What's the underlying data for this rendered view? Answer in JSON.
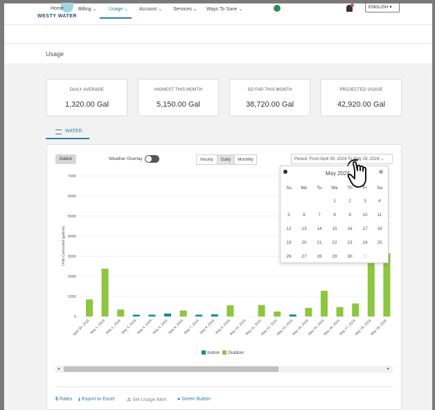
{
  "header": {
    "logo_text": "WESTY WATER",
    "language": "ENGLISH"
  },
  "nav": {
    "items": [
      {
        "label": "Home"
      },
      {
        "label": "Billing"
      },
      {
        "label": "Usage"
      },
      {
        "label": "Account"
      },
      {
        "label": "Services"
      },
      {
        "label": "Ways To Save"
      }
    ],
    "active": "Usage"
  },
  "page": {
    "title": "Usage"
  },
  "stats": [
    {
      "label": "DAILY AVERAGE",
      "value": "1,320.00 Gal"
    },
    {
      "label": "HIGHEST THIS MONTH",
      "value": "5,150.00 Gal"
    },
    {
      "label": "SO FAR THIS MONTH",
      "value": "38,720.00 Gal"
    },
    {
      "label": "PROJECTED USAGE",
      "value": "42,920.00 Gal"
    }
  ],
  "tabs": {
    "water": "WATER"
  },
  "controls": {
    "unit_button": "Gallon",
    "weather_overlay_label": "Weather Overlay",
    "weather_overlay_on": false,
    "intervals": [
      "Hourly",
      "Daily",
      "Monthly"
    ],
    "active_interval": "Daily",
    "period_label": "Period: From April 30, 2024 To May 29, 2024"
  },
  "calendar": {
    "title": "May 2024",
    "weekdays": [
      "Su",
      "Mo",
      "Tu",
      "We",
      "Th",
      "Fr",
      "Sa"
    ],
    "weeks": [
      [
        "",
        "",
        "",
        "1",
        "2",
        "3",
        "4"
      ],
      [
        "5",
        "6",
        "7",
        "8",
        "9",
        "10",
        "11"
      ],
      [
        "12",
        "13",
        "14",
        "15",
        "16",
        "17",
        "18"
      ],
      [
        "19",
        "20",
        "21",
        "22",
        "23",
        "24",
        "25"
      ],
      [
        "26",
        "27",
        "28",
        "29",
        "30",
        "31",
        ""
      ]
    ],
    "disabled_days": [
      "31"
    ]
  },
  "chart_data": {
    "type": "bar",
    "ylabel": "Units Consumed (gallons)",
    "ylim": [
      0,
      7000
    ],
    "yticks": [
      0,
      1000,
      2000,
      3000,
      4000,
      5000,
      6000,
      7000
    ],
    "categories": [
      "April 30, 2024",
      "May 1, 2024",
      "May 2, 2024",
      "May 3, 2024",
      "May 4, 2024",
      "May 5, 2024",
      "May 6, 2024",
      "May 7, 2024",
      "May 8, 2024",
      "May 9, 2024",
      "May 10, 2024",
      "May 11, 2024",
      "May 12, 2024",
      "May 13, 2024",
      "May 14, 2024",
      "May 15, 2024",
      "May 16, 2024",
      "May 17, 2024",
      "May 18, 2024",
      "May 19, 2024",
      "May"
    ],
    "series": [
      {
        "name": "Indoor",
        "color": "#1a8a9a",
        "values": [
          0,
          0,
          0,
          90,
          90,
          150,
          0,
          90,
          110,
          0,
          0,
          0,
          0,
          100,
          0,
          0,
          0,
          0,
          0,
          0,
          0
        ]
      },
      {
        "name": "Outdoor",
        "color": "#8dc63f",
        "values": [
          850,
          2380,
          350,
          0,
          0,
          0,
          300,
          0,
          0,
          560,
          0,
          570,
          250,
          0,
          430,
          1280,
          470,
          650,
          3200,
          3150,
          2800
        ]
      }
    ],
    "legend_position": "bottom-center",
    "grid": true
  },
  "footer": {
    "rates": "Rates",
    "export": "Export to Excel",
    "alert": "Set Usage Alert",
    "green_button": "Green Button"
  }
}
